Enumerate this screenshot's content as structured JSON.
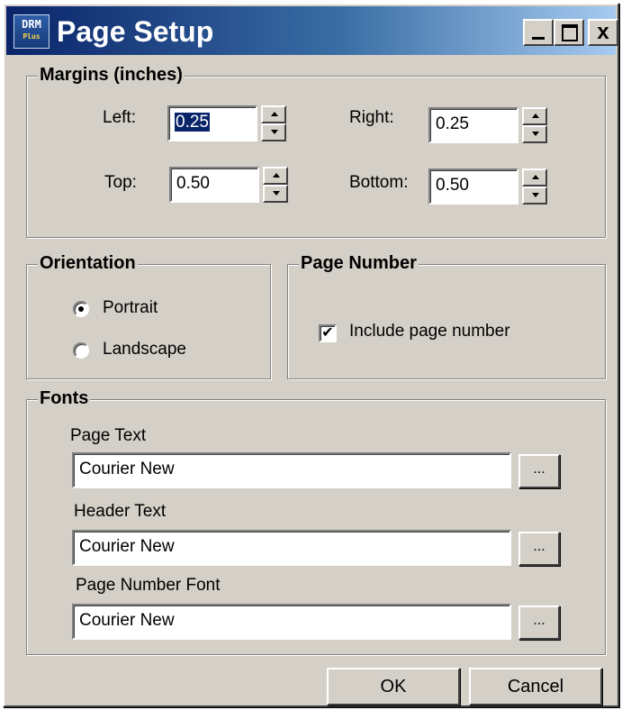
{
  "window": {
    "title": "Page Setup",
    "icon_text": "DRM",
    "icon_sub": "Plus",
    "min_icon": "minimize-icon",
    "max_icon": "maximize-icon",
    "close_label": "x"
  },
  "margins": {
    "legend": "Margins (inches)",
    "left_label": "Left:",
    "left_value": "0.25",
    "right_label": "Right:",
    "right_value": "0.25",
    "top_label": "Top:",
    "top_value": "0.50",
    "bottom_label": "Bottom:",
    "bottom_value": "0.50"
  },
  "orientation": {
    "legend": "Orientation",
    "portrait_label": "Portrait",
    "landscape_label": "Landscape",
    "selected": "Portrait"
  },
  "page_number": {
    "legend": "Page Number",
    "include_label": "Include page number",
    "include_checked": true,
    "check_mark": "✔"
  },
  "fonts": {
    "legend": "Fonts",
    "page_text_label": "Page Text",
    "page_text_value": "Courier New",
    "header_text_label": "Header Text",
    "header_text_value": "Courier New",
    "page_number_font_label": "Page Number Font",
    "page_number_font_value": "Courier New",
    "browse_label": "..."
  },
  "buttons": {
    "ok": "OK",
    "cancel": "Cancel"
  }
}
